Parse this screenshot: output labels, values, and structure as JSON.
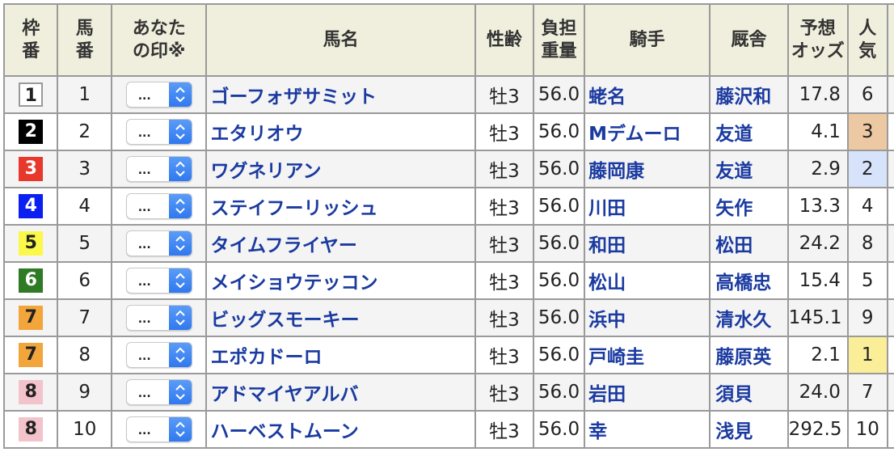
{
  "headers": {
    "waku": [
      "枠",
      "番"
    ],
    "umaban": [
      "馬",
      "番"
    ],
    "mark": [
      "あなた",
      "の印※"
    ],
    "name": "馬名",
    "sexage": "性齢",
    "weight": [
      "負担",
      "重量"
    ],
    "jockey": "騎手",
    "trainer": "厩舎",
    "odds": [
      "予想",
      "オッズ"
    ],
    "pop": [
      "人",
      "気"
    ]
  },
  "mark_placeholder": "...",
  "waku_colors": {
    "1": {
      "bg": "#ffffff",
      "fg": "#222222",
      "border": "#9a9a9a"
    },
    "2": {
      "bg": "#000000",
      "fg": "#ffffff"
    },
    "3": {
      "bg": "#e8382c",
      "fg": "#ffffff"
    },
    "4": {
      "bg": "#0a1ff0",
      "fg": "#ffffff"
    },
    "5": {
      "bg": "#fbf84a",
      "fg": "#222222"
    },
    "6": {
      "bg": "#2f7a25",
      "fg": "#ffffff"
    },
    "7": {
      "bg": "#f2a53b",
      "fg": "#222222"
    },
    "8": {
      "bg": "#f3c3cc",
      "fg": "#222222"
    }
  },
  "rows": [
    {
      "waku": "1",
      "umaban": "1",
      "name": "ゴーフォザサミット",
      "sexage": "牡3",
      "weight": "56.0",
      "jockey": "蛯名",
      "trainer": "藤沢和",
      "odds": "17.8",
      "pop": "6"
    },
    {
      "waku": "2",
      "umaban": "2",
      "name": "エタリオウ",
      "sexage": "牡3",
      "weight": "56.0",
      "jockey": "Mデムーロ",
      "trainer": "友道",
      "odds": "4.1",
      "pop": "3"
    },
    {
      "waku": "3",
      "umaban": "3",
      "name": "ワグネリアン",
      "sexage": "牡3",
      "weight": "56.0",
      "jockey": "藤岡康",
      "trainer": "友道",
      "odds": "2.9",
      "pop": "2"
    },
    {
      "waku": "4",
      "umaban": "4",
      "name": "ステイフーリッシュ",
      "sexage": "牡3",
      "weight": "56.0",
      "jockey": "川田",
      "trainer": "矢作",
      "odds": "13.3",
      "pop": "4"
    },
    {
      "waku": "5",
      "umaban": "5",
      "name": "タイムフライヤー",
      "sexage": "牡3",
      "weight": "56.0",
      "jockey": "和田",
      "trainer": "松田",
      "odds": "24.2",
      "pop": "8"
    },
    {
      "waku": "6",
      "umaban": "6",
      "name": "メイショウテッコン",
      "sexage": "牡3",
      "weight": "56.0",
      "jockey": "松山",
      "trainer": "高橋忠",
      "odds": "15.4",
      "pop": "5"
    },
    {
      "waku": "7",
      "umaban": "7",
      "name": "ビッグスモーキー",
      "sexage": "牡3",
      "weight": "56.0",
      "jockey": "浜中",
      "trainer": "清水久",
      "odds": "145.1",
      "pop": "9"
    },
    {
      "waku": "7",
      "umaban": "8",
      "name": "エポカドーロ",
      "sexage": "牡3",
      "weight": "56.0",
      "jockey": "戸崎圭",
      "trainer": "藤原英",
      "odds": "2.1",
      "pop": "1"
    },
    {
      "waku": "8",
      "umaban": "9",
      "name": "アドマイヤアルバ",
      "sexage": "牡3",
      "weight": "56.0",
      "jockey": "岩田",
      "trainer": "須貝",
      "odds": "24.0",
      "pop": "7"
    },
    {
      "waku": "8",
      "umaban": "10",
      "name": "ハーベストムーン",
      "sexage": "牡3",
      "weight": "56.0",
      "jockey": "幸",
      "trainer": "浅見",
      "odds": "292.5",
      "pop": "10"
    }
  ]
}
